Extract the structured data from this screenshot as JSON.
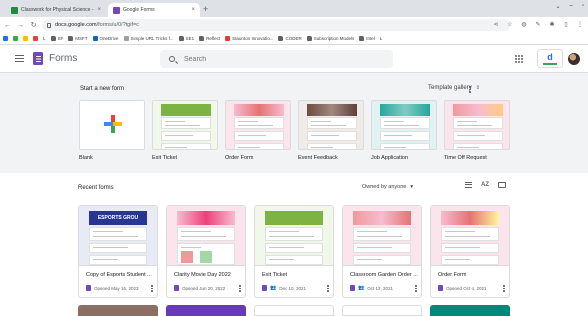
{
  "browser": {
    "tabs": [
      {
        "title": "Classwork for Physical Science -",
        "active": false,
        "favicon_color": "#1e8e3e"
      },
      {
        "title": "Google Forms",
        "active": true,
        "favicon_color": "#7248b9"
      }
    ],
    "new_tab_glyph": "+",
    "window_controls": [
      "⌄",
      "–",
      "▫"
    ],
    "url_host": "docs.google.com",
    "url_path": "/forms/u/0/?tgif=c",
    "omnibox_icons": [
      "share-icon",
      "star-icon",
      "extension-icon",
      "pen-icon",
      "puzzle-icon",
      "sidebar-icon",
      "more-icon"
    ],
    "bookmarks": [
      {
        "label": "",
        "kind": "app"
      },
      {
        "label": "",
        "kind": "app"
      },
      {
        "label": "",
        "kind": "app"
      },
      {
        "label": "",
        "kind": "app"
      },
      {
        "label": "L",
        "kind": "app"
      },
      {
        "label": "SF",
        "kind": "folder"
      },
      {
        "label": "MSFT",
        "kind": "folder"
      },
      {
        "label": "OneDrive",
        "kind": "app"
      },
      {
        "label": "Simple URL Tricks f...",
        "kind": "app"
      },
      {
        "label": "SE1",
        "kind": "folder"
      },
      {
        "label": "Reflect",
        "kind": "folder"
      },
      {
        "label": "Staunton Innovatio...",
        "kind": "app"
      },
      {
        "label": "CODER",
        "kind": "folder"
      },
      {
        "label": "Subscription Models",
        "kind": "folder"
      },
      {
        "label": "Intel",
        "kind": "folder"
      },
      {
        "label": "L",
        "kind": "app"
      }
    ]
  },
  "app": {
    "name": "Forms",
    "search_placeholder": "Search",
    "account_badge_letter": "d"
  },
  "start": {
    "heading": "Start a new form",
    "gallery_label": "Template gallery",
    "templates": [
      {
        "label": "Blank",
        "header_color": "#ffffff"
      },
      {
        "label": "Exit Ticket",
        "header_color": "#7cb342"
      },
      {
        "label": "Order Form",
        "header_color": "#f48fb1"
      },
      {
        "label": "Event Feedback",
        "header_color": "#8d6e63"
      },
      {
        "label": "Job Application",
        "header_color": "#26a69a"
      },
      {
        "label": "Time Off Request",
        "header_color": "#ef9a9a"
      }
    ]
  },
  "recent": {
    "heading": "Recent forms",
    "owner_filter": "Owned by anyone",
    "owner_caret": "▾",
    "sort_label": "AZ",
    "forms": [
      {
        "title": "Copy of Esports Student ...",
        "opened": "Opened May 16, 2023",
        "shared": false,
        "preview_color": "#3949ab",
        "preview_text": "ESPORTS GROU"
      },
      {
        "title": "Clarity Movie Day 2022",
        "opened": "Opened Jun 20, 2022",
        "shared": false,
        "preview_color": "#ec407a",
        "preview_text": ""
      },
      {
        "title": "Exit Ticket",
        "opened": "Dec 10, 2021",
        "shared": true,
        "preview_color": "#7cb342",
        "preview_text": ""
      },
      {
        "title": "Classroom Garden Order ...",
        "opened": "Oct 13, 2021",
        "shared": true,
        "preview_color": "#ef9a9a",
        "preview_text": ""
      },
      {
        "title": "Order Form",
        "opened": "Opened Oct 4, 2021",
        "shared": false,
        "preview_color": "#f48fb1",
        "preview_text": ""
      }
    ],
    "next_row_colors": [
      "#8d6e63",
      "#673ab7",
      "#ffffff",
      "#ffffff",
      "#00897b"
    ]
  }
}
